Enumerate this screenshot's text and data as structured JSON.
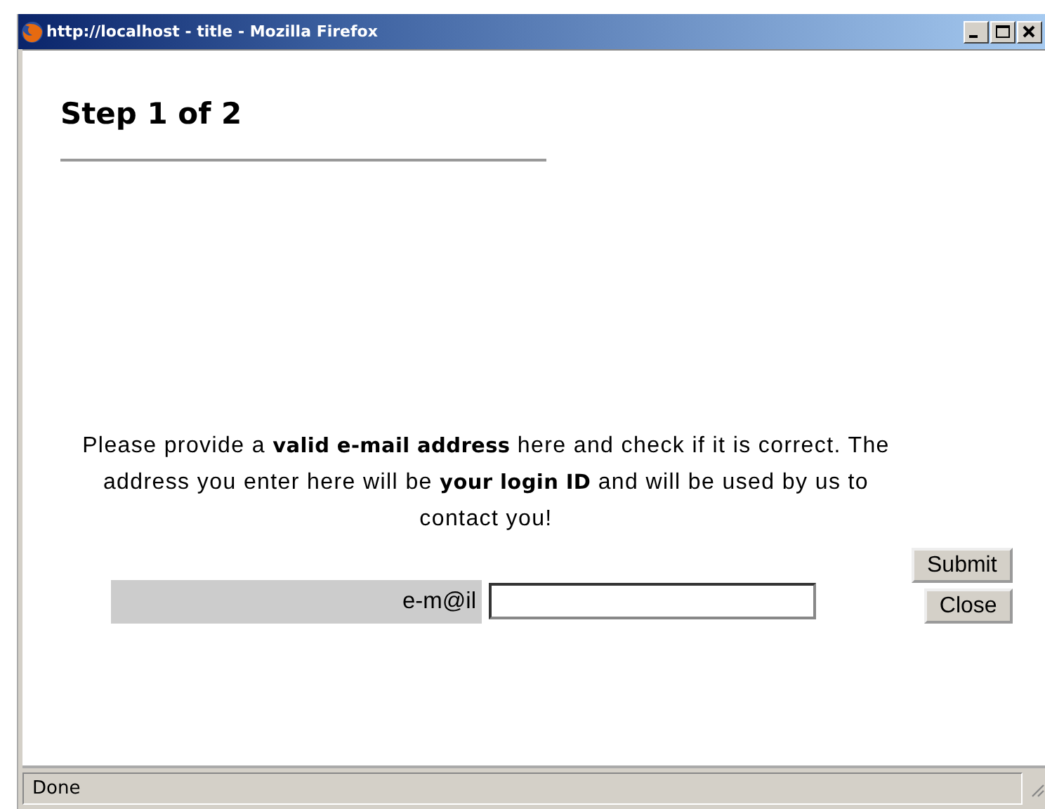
{
  "window": {
    "title": "http://localhost - title - Mozilla Firefox"
  },
  "heading": "Step 1 of 2",
  "message": "Please provide a **valid e-mail address** here and check if it is correct. The address you enter here will be **your login ID** and will be used by us to contact you!",
  "form": {
    "label": "e-m@il"
  },
  "buttons": [
    {
      "label": "Submit"
    },
    {
      "label": "Close"
    }
  ],
  "status_bar": "Done"
}
